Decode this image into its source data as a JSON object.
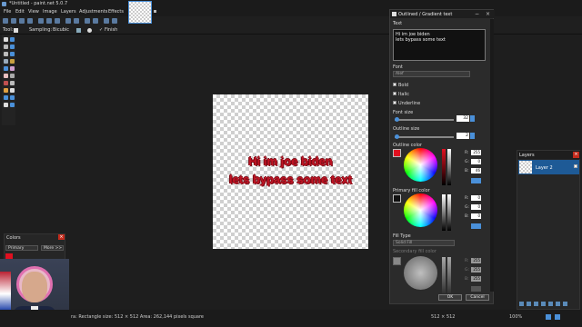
{
  "window": {
    "title": "*Untitled - paint.net 5.0.7"
  },
  "menu": [
    "File",
    "Edit",
    "View",
    "Image",
    "Layers",
    "Adjustments",
    "Effects"
  ],
  "toolbar2": {
    "tool_label": "Tool:",
    "sampling_label": "Sampling:",
    "sampling_value": "Bicubic",
    "finish_label": "Finish"
  },
  "canvas": {
    "line1": "Hi im joe biden",
    "line2": "lets bypass some text",
    "text_color": "#c11424"
  },
  "colors_panel": {
    "title": "Colors",
    "mode": "Primary",
    "more_label": "More >>"
  },
  "status": {
    "selection_text": "ra: Rectangle size: 512 × 512  Area: 262,144 pixels square",
    "coords": "512 × 512",
    "zoom": "100%"
  },
  "dialog": {
    "title": "Outlined / Gradient text",
    "text_label": "Text",
    "text_value_line1": "Hi im joe biden",
    "text_value_line2": "lets bypass some text",
    "font_label": "Font",
    "font_value": "Alef",
    "bold_label": "Bold",
    "italic_label": "Italic",
    "underline_label": "Underline",
    "font_size_label": "Font size",
    "font_size_value": "32",
    "outline_size_label": "Outline size",
    "outline_size_value": "2",
    "outline_color_label": "Outline color",
    "outline_color": {
      "hex": "#e01020",
      "r": "255",
      "g": "0",
      "b": "46"
    },
    "primary_fill_label": "Primary fill color",
    "primary_fill": {
      "hex": "#111111",
      "r": "0",
      "g": "0",
      "b": "0"
    },
    "fill_type_label": "Fill Type",
    "fill_type_value": "Solid Fill",
    "secondary_fill_label": "Secondary fill color",
    "secondary_fill": {
      "r": "255",
      "g": "255",
      "b": "255"
    },
    "ok_label": "OK",
    "cancel_label": "Cancel"
  },
  "layers_panel": {
    "title": "Layers",
    "layer_name": "Layer 2"
  },
  "accent_color": "#4a90d9"
}
